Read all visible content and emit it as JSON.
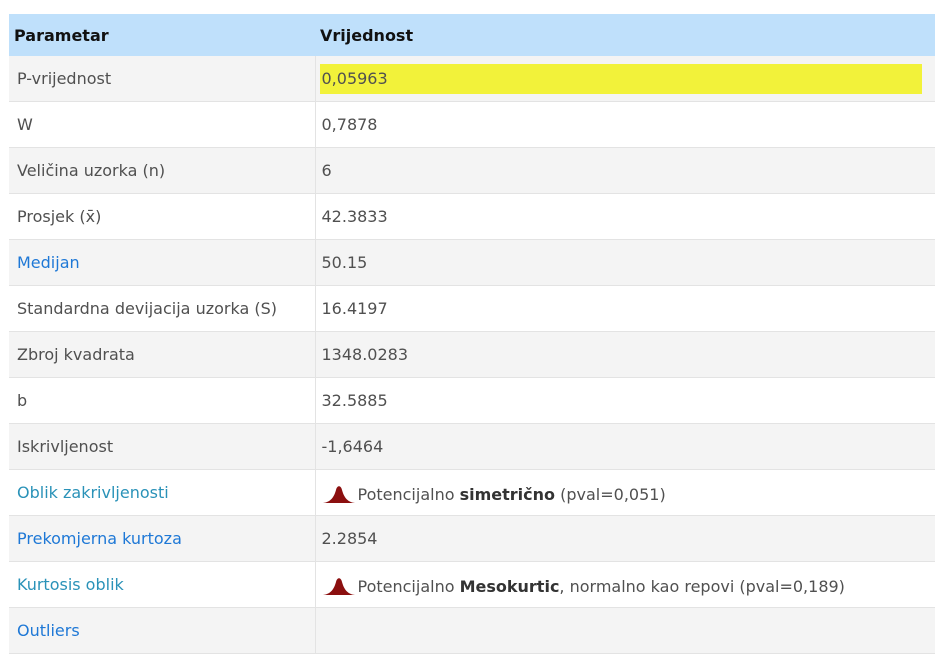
{
  "table": {
    "headers": {
      "param": "Parametar",
      "value": "Vrijednost"
    },
    "rows": [
      {
        "label": "P-vrijednost",
        "value": "0,05963"
      },
      {
        "label": "W",
        "value": "0,7878"
      },
      {
        "label": "Veličina uzorka (n)",
        "value": "6"
      },
      {
        "label": "Prosjek (x̄)",
        "value": "42.3833"
      },
      {
        "label": "Medijan",
        "value": "50.15"
      },
      {
        "label": "Standardna devijacija uzorka (S)",
        "value": "16.4197"
      },
      {
        "label": "Zbroj kvadrata",
        "value": "1348.0283"
      },
      {
        "label": "b",
        "value": "32.5885"
      },
      {
        "label": "Iskrivljenost",
        "value": "-1,6464"
      },
      {
        "label": "Oblik zakrivljenosti",
        "value_prefix": "Potencijalno",
        "value_strong": "simetrično",
        "value_suffix": "(pval=0,051)",
        "icon": "distribution-peak-icon"
      },
      {
        "label": "Prekomjerna kurtoza",
        "value": "2.2854"
      },
      {
        "label": "Kurtosis oblik",
        "value_prefix": "Potencijalno",
        "value_strong": "Mesokurtic",
        "value_suffix": ", normalno kao repovi (pval=0,189)",
        "icon": "distribution-peak-icon"
      },
      {
        "label": "Outliers",
        "value": ""
      }
    ]
  },
  "colors": {
    "header_bg": "#bfe0fb",
    "highlight": "#f2f23a",
    "link_blue": "#1e78d6",
    "link_teal": "#2a92b8",
    "peak_icon": "#8b0f0f"
  }
}
